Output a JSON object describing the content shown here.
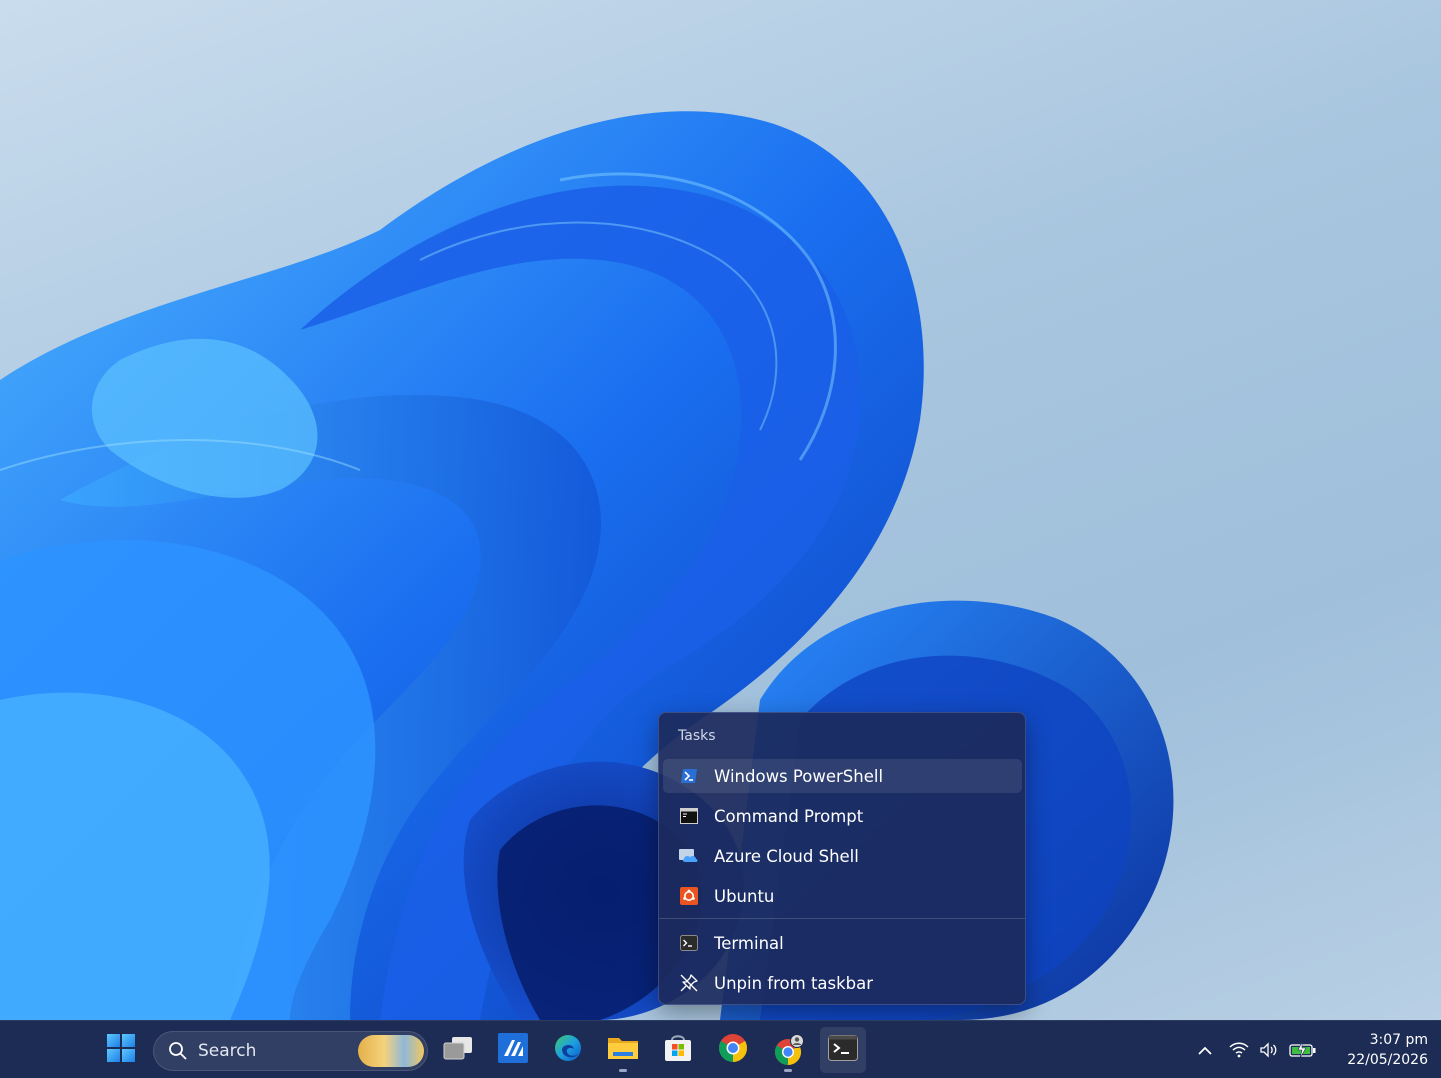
{
  "jumplist": {
    "heading": "Tasks",
    "items": [
      {
        "label": "Windows PowerShell",
        "icon": "powershell-icon"
      },
      {
        "label": "Command Prompt",
        "icon": "command-prompt-icon"
      },
      {
        "label": "Azure Cloud Shell",
        "icon": "azure-cloud-shell-icon"
      },
      {
        "label": "Ubuntu",
        "icon": "ubuntu-icon"
      },
      {
        "label": "Terminal",
        "icon": "terminal-icon"
      },
      {
        "label": "Unpin from taskbar",
        "icon": "unpin-icon"
      }
    ]
  },
  "taskbar": {
    "search_label": "Search",
    "apps": [
      {
        "name": "start",
        "icon": "windows-start-icon"
      },
      {
        "name": "task-view",
        "icon": "task-view-icon"
      },
      {
        "name": "azure-data-studio",
        "icon": "azure-app-icon"
      },
      {
        "name": "edge",
        "icon": "edge-icon"
      },
      {
        "name": "file-explorer",
        "icon": "folder-icon"
      },
      {
        "name": "microsoft-store",
        "icon": "store-icon"
      },
      {
        "name": "chrome",
        "icon": "chrome-icon"
      },
      {
        "name": "chrome-profile",
        "icon": "chrome-profile-icon"
      },
      {
        "name": "terminal",
        "icon": "terminal-icon"
      }
    ]
  },
  "tray": {
    "time": "3:07 pm",
    "date": "22/05/2026"
  },
  "colors": {
    "taskbar_bg": "#1d2c55",
    "jumplist_bg": "#1c2a5c",
    "accent": "#2a7de1"
  }
}
